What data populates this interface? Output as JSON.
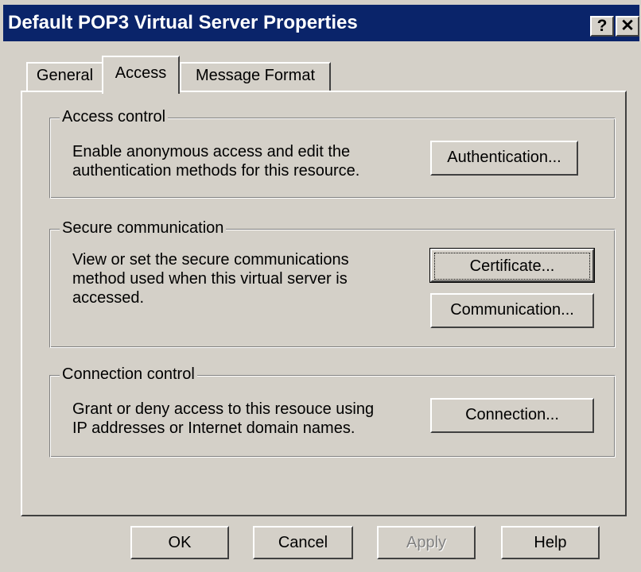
{
  "window": {
    "title": "Default POP3 Virtual Server Properties",
    "help_label": "?",
    "close_label": "✕"
  },
  "tabs": [
    {
      "label": "General",
      "selected": false
    },
    {
      "label": "Access",
      "selected": true
    },
    {
      "label": "Message Format",
      "selected": false
    }
  ],
  "access_control": {
    "title": "Access control",
    "description_line1": "Enable anonymous access and edit the",
    "description_line2": "authentication methods for this resource.",
    "button_label": "Authentication..."
  },
  "secure_communication": {
    "title": "Secure communication",
    "description_line1": "View or set the secure communications",
    "description_line2": "method used when this virtual server is",
    "description_line3": "accessed.",
    "certificate_label": "Certificate...",
    "communication_label": "Communication..."
  },
  "connection_control": {
    "title": "Connection control",
    "description_line1": "Grant or deny access to this resouce using",
    "description_line2": "IP addresses or Internet domain names.",
    "button_label": "Connection..."
  },
  "footer": {
    "ok": "OK",
    "cancel": "Cancel",
    "apply": "Apply",
    "help": "Help"
  }
}
